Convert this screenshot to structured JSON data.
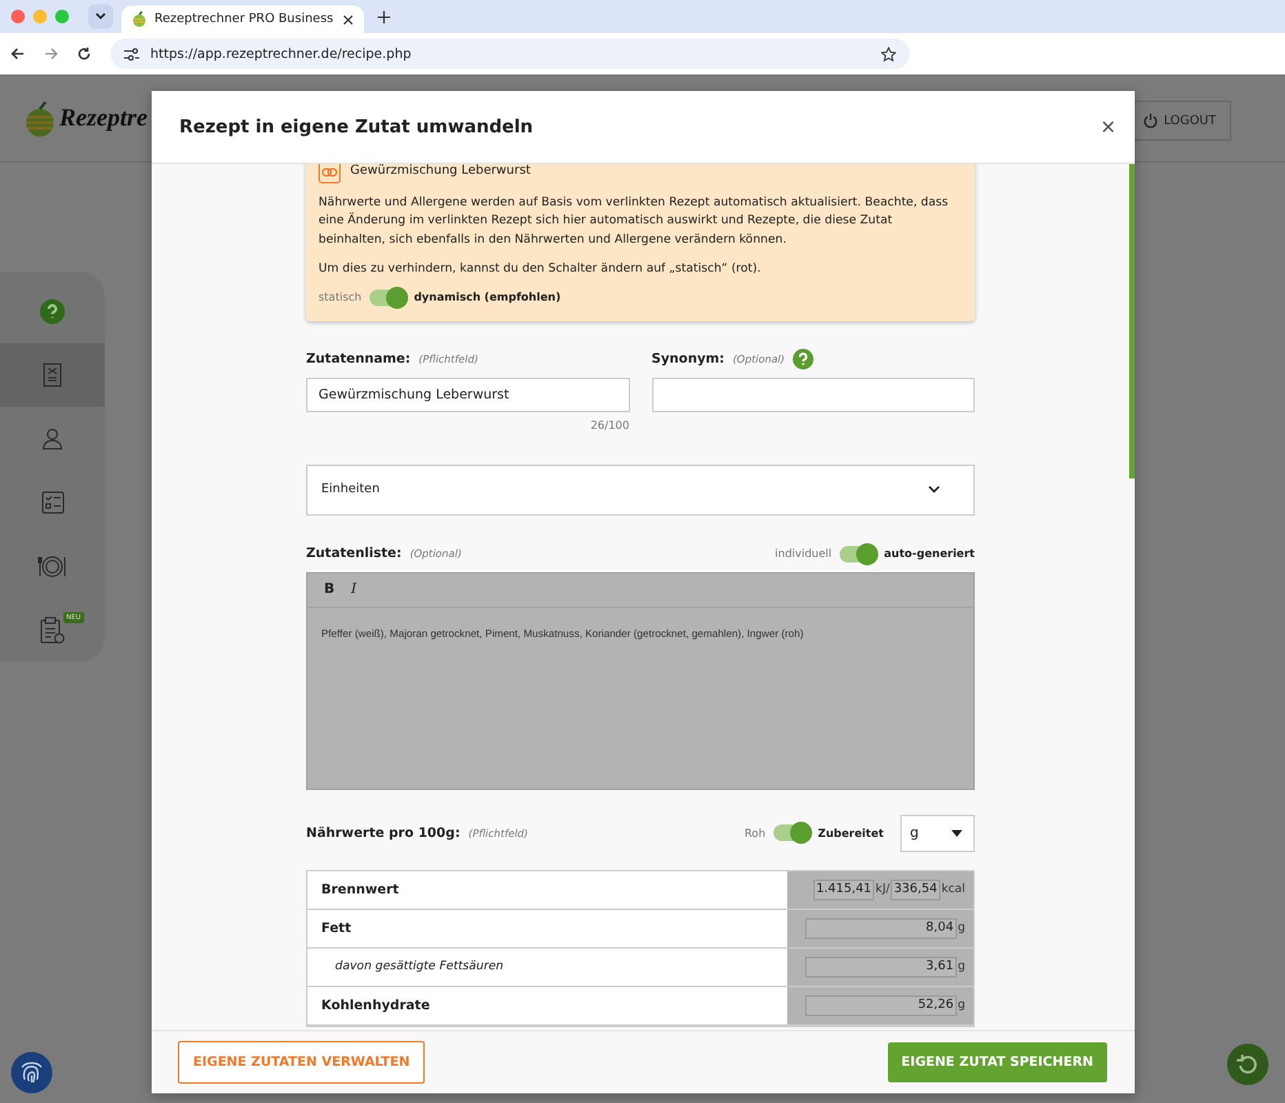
{
  "browser": {
    "tab_title": "Rezeptrechner PRO Business",
    "url": "https://app.rezeptrechner.de/recipe.php"
  },
  "app": {
    "logo_text": "Rezeptre",
    "logout": "LOGOUT",
    "sidebar": [
      {
        "kind": "help",
        "selected": false
      },
      {
        "kind": "document",
        "selected": true
      },
      {
        "kind": "user",
        "selected": false
      },
      {
        "kind": "checklist",
        "selected": false
      },
      {
        "kind": "plate",
        "selected": false
      },
      {
        "kind": "clipboard",
        "selected": false,
        "badge": "NEU"
      }
    ]
  },
  "modal": {
    "title": "Rezept in eigene Zutat umwandeln",
    "close": "×",
    "notice": {
      "title": "Gewürzmischung Leberwurst",
      "paragraphs": [
        "Nährwerte und Allergene werden auf Basis vom verlinkten Rezept automatisch aktualisiert. Beachte, dass eine Änderung im verlinkten Rezept sich hier automatisch auswirkt und Rezepte, die diese Zutat beinhalten, sich ebenfalls in den Nährwerten und Allergene verändern können.",
        "Um dies zu verhindern, kannst du den Schalter ändern auf „statisch“ (rot)."
      ],
      "toggle": {
        "off_label": "statisch",
        "on_label": "dynamisch (empfohlen)",
        "on": true
      }
    },
    "fields": [
      {
        "label": "Zutatenname:",
        "hint": "(Pflichtfeld)",
        "help": false,
        "value": "Gewürzmischung Leberwurst",
        "counter": "26/100"
      },
      {
        "label": "Synonym:",
        "hint": "(Optional)",
        "help": true
      }
    ],
    "units": {
      "label": "Einheiten",
      "expanded": false
    },
    "ingredients_list": {
      "label": "Zutatenliste:",
      "hint": "(Optional)",
      "toggle": {
        "off_label": "individuell",
        "on_label": "auto-generiert",
        "on": true
      },
      "toolbar": [
        {
          "label": "B",
          "kind": "bold"
        },
        {
          "label": "I",
          "kind": "italic"
        }
      ],
      "text": "Pfeffer (weiß), Majoran getrocknet, Piment, Muskatnuss, Koriander (getrocknet, gemahlen), Ingwer (roh)"
    },
    "nutrition": {
      "label": "Nährwerte pro 100g:",
      "hint": "(Pflichtfeld)",
      "toggle": {
        "off_label": "Roh",
        "on_label": "Zubereitet",
        "on": true
      },
      "unit_select": "g",
      "rows": [
        {
          "name": "Brennwert",
          "kind": "main",
          "values": [
            {
              "value": "1.415,41",
              "unit": "kJ/"
            },
            {
              "value": "336,54",
              "unit": "kcal"
            }
          ]
        },
        {
          "name": "Fett",
          "kind": "main",
          "values": [
            {
              "value": "8,04",
              "unit": "g"
            }
          ]
        },
        {
          "name": "davon gesättigte Fettsäuren",
          "kind": "sub",
          "values": [
            {
              "value": "3,61",
              "unit": "g"
            }
          ]
        },
        {
          "name": "Kohlenhydrate",
          "kind": "main",
          "values": [
            {
              "value": "52,26",
              "unit": "g"
            }
          ]
        }
      ]
    },
    "footer": {
      "secondary": "EIGENE ZUTATEN VERWALTEN",
      "primary": "EIGENE ZUTAT SPEICHERN"
    }
  }
}
